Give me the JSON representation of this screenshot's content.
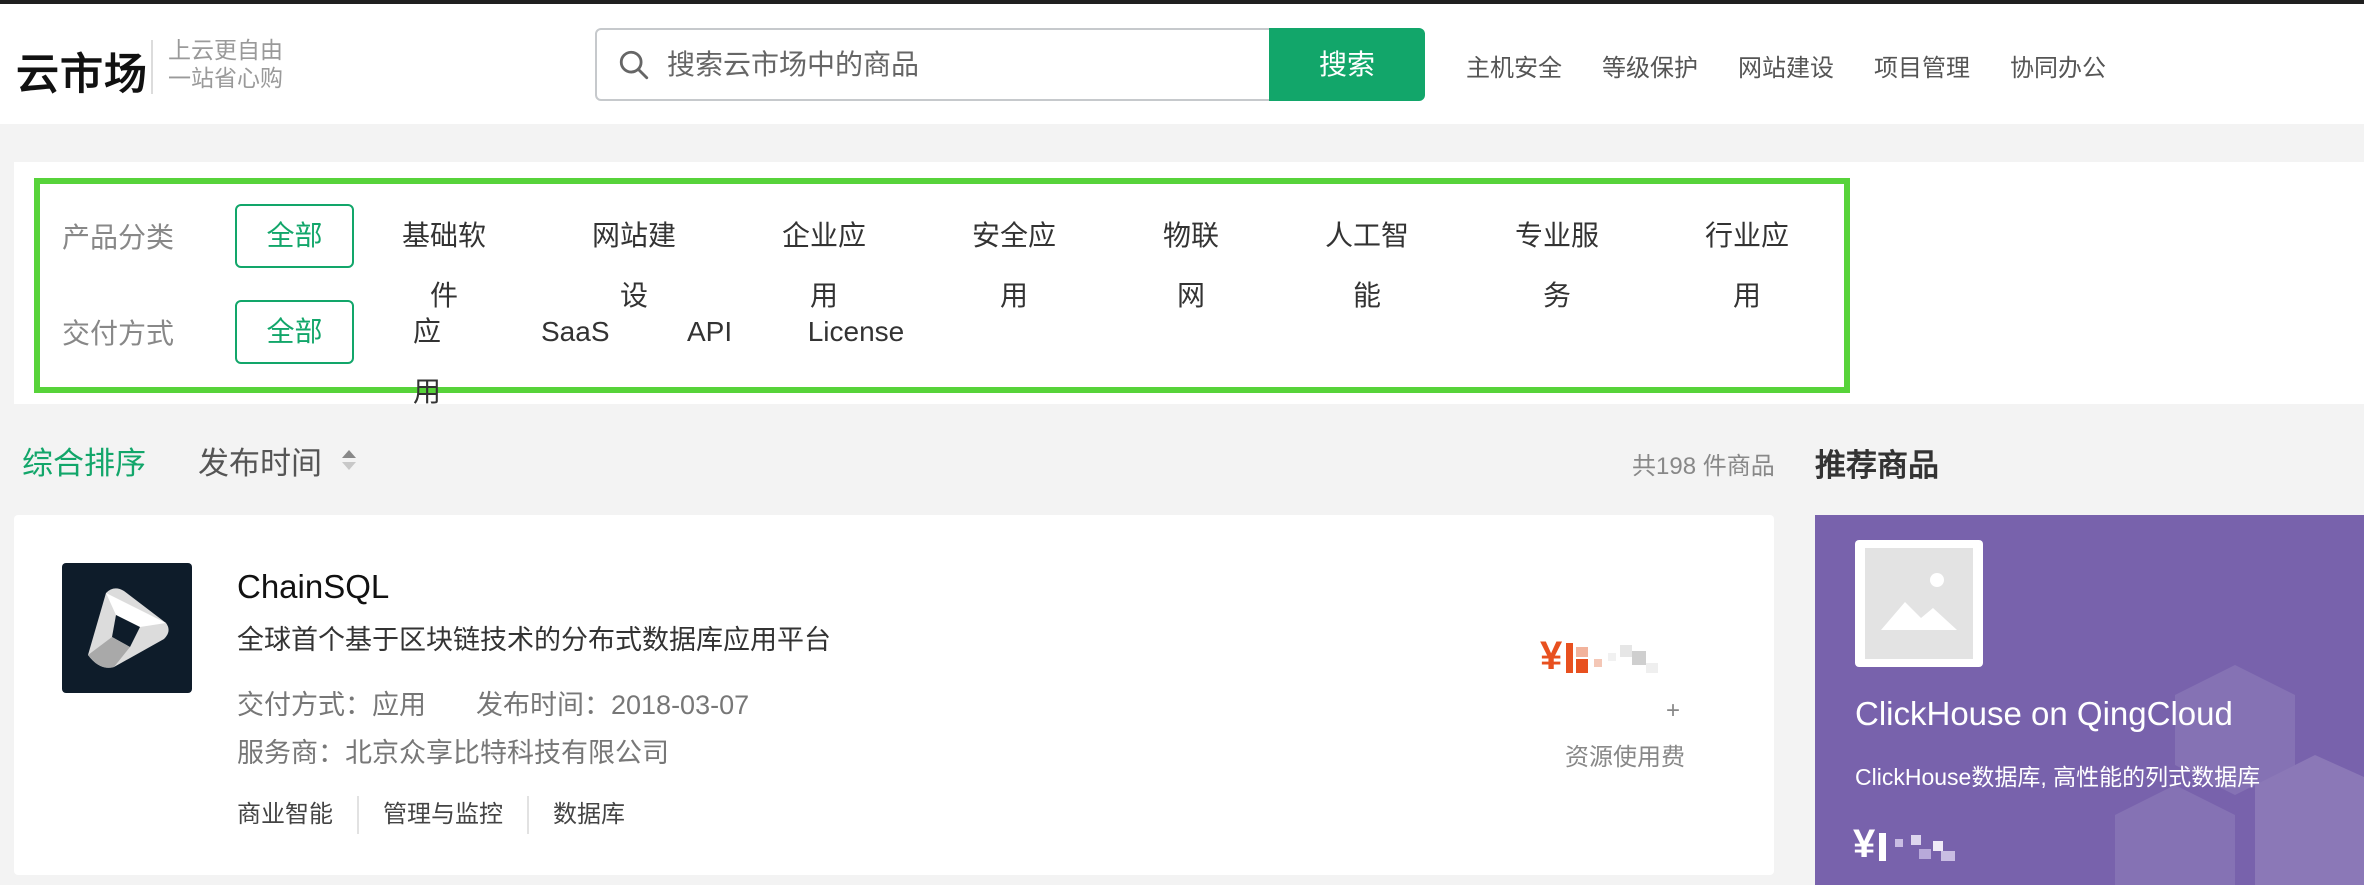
{
  "brand": {
    "logo": "云市场",
    "slogan_line1": "上云更自由",
    "slogan_line2": "一站省心购"
  },
  "search": {
    "placeholder": "搜索云市场中的商品",
    "button": "搜索"
  },
  "hot_links": [
    "主机安全",
    "等级保护",
    "网站建设",
    "项目管理",
    "协同办公"
  ],
  "filters": {
    "category": {
      "label": "产品分类",
      "options": [
        "全部",
        "基础软件",
        "网站建设",
        "企业应用",
        "安全应用",
        "物联网",
        "人工智能",
        "专业服务",
        "行业应用"
      ],
      "selected": "全部"
    },
    "delivery": {
      "label": "交付方式",
      "options": [
        "全部",
        "应用",
        "SaaS",
        "API",
        "License"
      ],
      "selected": "全部"
    }
  },
  "sort": {
    "comprehensive": "综合排序",
    "publish_time": "发布时间"
  },
  "total": "共198 件商品",
  "recommend_title": "推荐商品",
  "product": {
    "name": "ChainSQL",
    "desc": "全球首个基于区块链技术的分布式数据库应用平台",
    "delivery_label": "交付方式：",
    "delivery_value": "应用",
    "publish_label": "发布时间：",
    "publish_value": "2018-03-07",
    "provider_label": "服务商：",
    "provider_value": "北京众享比特科技有限公司",
    "tags": [
      "商业智能",
      "管理与监控",
      "数据库"
    ],
    "price_symbol": "¥",
    "plus": "+",
    "resource_fee": "资源使用费"
  },
  "recommended": {
    "name": "ClickHouse on QingCloud",
    "desc": "ClickHouse数据库, 高性能的列式数据库",
    "price_symbol": "¥"
  },
  "colors": {
    "accent": "#12a66a",
    "price": "#e8501f",
    "highlight_box": "#57d33a",
    "rec_bg": "#7862ac"
  }
}
